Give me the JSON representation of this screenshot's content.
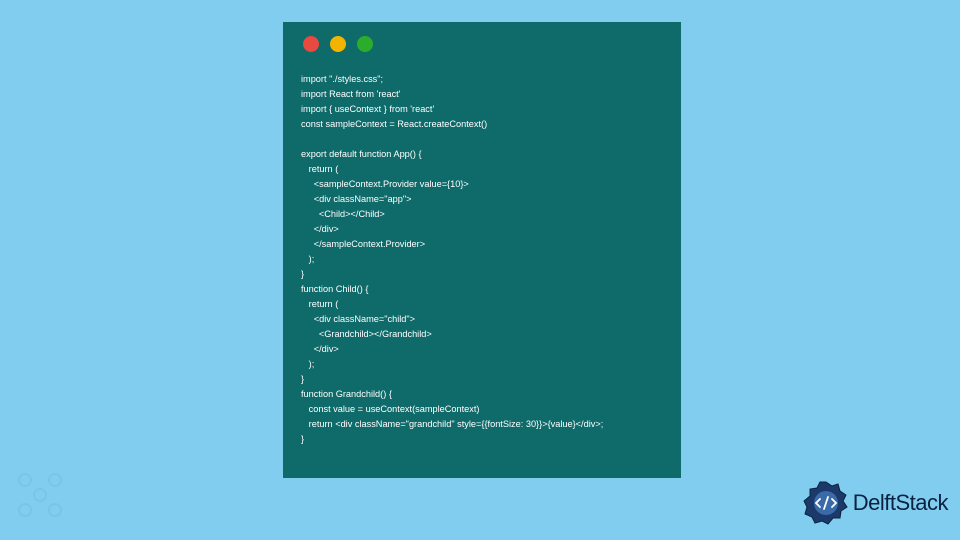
{
  "code": {
    "lines": [
      "import \"./styles.css\";",
      "import React from 'react'",
      "import { useContext } from 'react'",
      "const sampleContext = React.createContext()",
      "",
      "export default function App() {",
      "   return (",
      "     <sampleContext.Provider value={10}>",
      "     <div className=\"app\">",
      "       <Child></Child>",
      "     </div>",
      "     </sampleContext.Provider>",
      "   );",
      "}",
      "function Child() {",
      "   return (",
      "     <div className=\"child\">",
      "       <Grandchild></Grandchild>",
      "     </div>",
      "   );",
      "}",
      "function Grandchild() {",
      "   const value = useContext(sampleContext)",
      "   return <div className=\"grandchild\" style={{fontSize: 30}}>{value}</div>;",
      "}"
    ]
  },
  "brand": {
    "name": "DelftStack"
  }
}
